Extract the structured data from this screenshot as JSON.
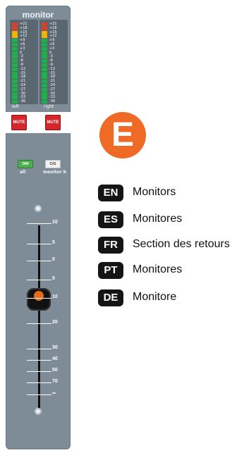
{
  "strip": {
    "title": "monitor",
    "meter_left_caption": "left",
    "meter_right_caption": "right",
    "meter_labels": [
      "+21",
      "+18",
      "+15",
      "+12",
      "+9",
      "+6",
      "+3",
      "0",
      "-3",
      "-6",
      "-9",
      "-12",
      "-15",
      "-18",
      "-21",
      "-24",
      "-27",
      "-30",
      "-33",
      "-36"
    ],
    "mute_left_label": "MUTE",
    "mute_right_label": "MUTE",
    "dim_label": "DIM",
    "cio_label": "C/O",
    "dim_caption": "all",
    "monitor_caption": "monitor b",
    "fader_scale": [
      "10",
      "5",
      "0",
      "5",
      "10",
      "20",
      "30",
      "40",
      "50",
      "70",
      "∞"
    ]
  },
  "badge": {
    "letter": "E"
  },
  "languages": [
    {
      "code": "EN",
      "text": "Monitors"
    },
    {
      "code": "ES",
      "text": "Monitores"
    },
    {
      "code": "FR",
      "text": "Section des retours"
    },
    {
      "code": "PT",
      "text": "Monitores"
    },
    {
      "code": "DE",
      "text": "Monitore"
    }
  ]
}
